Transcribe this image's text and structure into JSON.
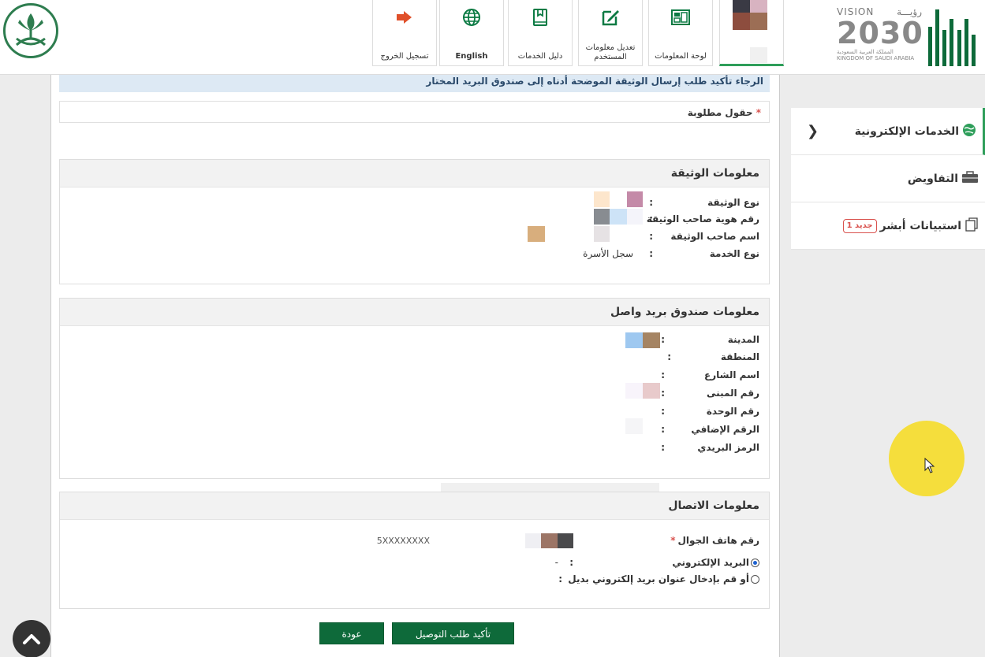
{
  "header": {
    "nav": [
      {
        "id": "logout",
        "label": "تسجيل الخروج",
        "icon": "logout-icon"
      },
      {
        "id": "english",
        "label": "English",
        "icon": "globe-icon"
      },
      {
        "id": "guide",
        "label": "دليل الخدمات",
        "icon": "book-icon"
      },
      {
        "id": "edit",
        "label": "تعديل معلومات المستخدم",
        "icon": "edit-icon"
      },
      {
        "id": "dashboard",
        "label": "لوحة المعلومات",
        "icon": "dashboard-icon"
      }
    ],
    "vision": {
      "top_en": "VISION",
      "top_ar": "رؤيـــة",
      "year": "2030",
      "line1": "المملكة العربية السعودية",
      "line2": "KINGDOM OF SAUDI ARABIA"
    }
  },
  "main": {
    "notice": "الرجاء تأكيد طلب إرسال الوثيقة الموضحة أدناه إلى صندوق البريد المختار",
    "required_star": "*",
    "required_label": "حقول مطلوبة",
    "doc_section": {
      "title": "معلومات الوثيقة",
      "rows": [
        {
          "label": "نوع الوثيقة",
          "colon": ":",
          "value": ""
        },
        {
          "label": "رقم هوية صاحب الوثيقة",
          "colon": ":",
          "value": ""
        },
        {
          "label": "اسم صاحب الوثيقة",
          "colon": ":",
          "value": ""
        },
        {
          "label": "نوع الخدمة",
          "colon": ":",
          "value": "سجل الأسرة"
        }
      ]
    },
    "mailbox_section": {
      "title": "معلومات صندوق بريد واصل",
      "rows": [
        {
          "label": "المدينة",
          "colon": ":"
        },
        {
          "label": "المنطقة",
          "colon": ":"
        },
        {
          "label": "اسم الشارع",
          "colon": ":"
        },
        {
          "label": "رقم المبنى",
          "colon": ":"
        },
        {
          "label": "رقم الوحدة",
          "colon": ":"
        },
        {
          "label": "الرقم الإضافي",
          "colon": ":"
        },
        {
          "label": "الرمز البريدي",
          "colon": ":"
        }
      ]
    },
    "contact_section": {
      "title": "معلومات الاتصال",
      "phone_label": "رقم هاتف الجوال",
      "phone_star": "*",
      "phone_value": "5XXXXXXXX",
      "email_option": "البريد الإلكتروني",
      "email_colon": ":",
      "email_value": "-",
      "alt_email_option": "أو قم بإدخال عنوان بريد إلكتروني بديل",
      "alt_email_colon": ":"
    },
    "buttons": {
      "confirm": "تأكيد طلب التوصيل",
      "back": "عودة"
    }
  },
  "sidebar": {
    "items": [
      {
        "label": "الخدمات الإلكترونية",
        "icon": "globe-icon",
        "active": true
      },
      {
        "label": "التفاويض",
        "icon": "briefcase-icon"
      },
      {
        "label": "استبيانات أبشر",
        "icon": "survey-icon",
        "badge": "جديد 1"
      }
    ]
  },
  "colors": {
    "brand_green": "#0e6a3a",
    "accent_green": "#2e9e5a",
    "logout_orange": "#e0502a",
    "notice_bg": "#dde9f4",
    "highlight": "#f5dc2c"
  }
}
